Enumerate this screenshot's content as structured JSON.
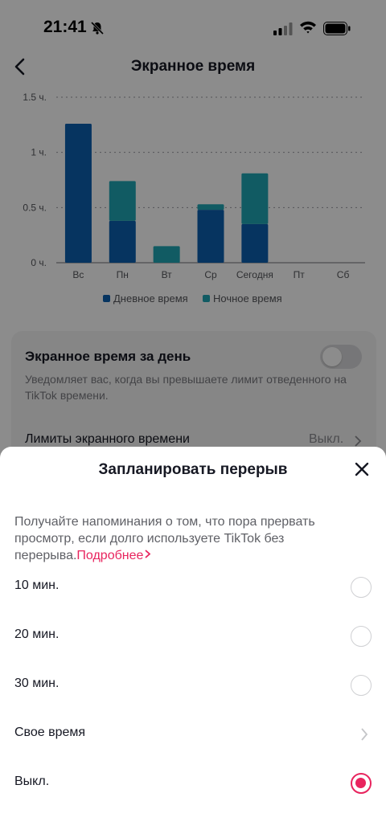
{
  "status_bar": {
    "time": "21:41"
  },
  "header": {
    "title": "Экранное время"
  },
  "chart_data": {
    "type": "bar",
    "stacked": true,
    "categories": [
      "Вс",
      "Пн",
      "Вт",
      "Ср",
      "Сегодня",
      "Пт",
      "Сб"
    ],
    "series": [
      {
        "name": "Дневное время",
        "color": "#0b5fb0",
        "values": [
          1.26,
          0.38,
          0,
          0.48,
          0.35,
          0,
          0
        ]
      },
      {
        "name": "Ночное время",
        "color": "#20a7b4",
        "values": [
          0,
          0.36,
          0.15,
          0.05,
          0.46,
          0,
          0
        ]
      }
    ],
    "y_ticks": [
      {
        "value": 0,
        "label": "0 ч."
      },
      {
        "value": 0.5,
        "label": "0.5 ч."
      },
      {
        "value": 1,
        "label": "1 ч."
      },
      {
        "value": 1.5,
        "label": "1.5 ч."
      }
    ],
    "ylim": [
      0,
      1.5
    ],
    "grid": true,
    "legend_position": "bottom"
  },
  "card": {
    "daily_title": "Экранное время за день",
    "daily_desc": "Уведомляет вас, когда вы превышаете лимит отведенного на TikTok времени.",
    "limits_label": "Лимиты экранного времени",
    "limits_value": "Выкл."
  },
  "sheet": {
    "title": "Запланировать перерыв",
    "description": "Получайте напоминания о том, что пора прервать просмотр, если долго используете TikTok без перерыва.",
    "more_link": "Подробнее",
    "options": [
      {
        "label": "10 мин.",
        "selected": false
      },
      {
        "label": "20 мин.",
        "selected": false
      },
      {
        "label": "30 мин.",
        "selected": false
      },
      {
        "label": "Свое время"
      },
      {
        "label": "Выкл.",
        "selected": true
      }
    ]
  },
  "colors": {
    "accent": "#e8245e",
    "day": "#0b5fb0",
    "night": "#20a7b4"
  }
}
